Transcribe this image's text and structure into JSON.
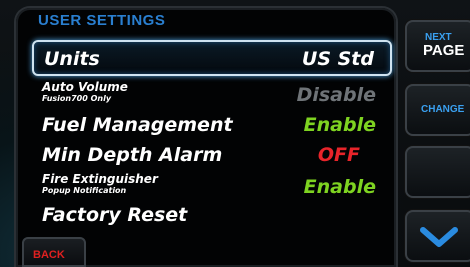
{
  "title": "USER SETTINGS",
  "rows": [
    {
      "label": "Units",
      "sublabel": "",
      "value": "US Std",
      "value_color": "#ffffff"
    },
    {
      "label": "Auto Volume",
      "sublabel": "Fusion700 Only",
      "value": "Disable",
      "value_color": "#6f7478"
    },
    {
      "label": "Fuel Management",
      "sublabel": "",
      "value": "Enable",
      "value_color": "#7ed321"
    },
    {
      "label": "Min Depth Alarm",
      "sublabel": "",
      "value": "OFF",
      "value_color": "#e8242a"
    },
    {
      "label": "Fire Extinguisher",
      "sublabel": "Popup Notification",
      "value": "Enable",
      "value_color": "#7ed321"
    },
    {
      "label": "Factory Reset",
      "sublabel": "",
      "value": "",
      "value_color": "#ffffff"
    }
  ],
  "side": {
    "next_top": "NEXT",
    "next_bottom": "PAGE",
    "change": "CHANGE",
    "blank": "",
    "down_icon": "chevron-down-icon"
  },
  "back_label": "BACK",
  "colors": {
    "accent_blue": "#2a7fd0",
    "enabled": "#7ed321",
    "off": "#e8242a",
    "disabled": "#6f7478"
  }
}
